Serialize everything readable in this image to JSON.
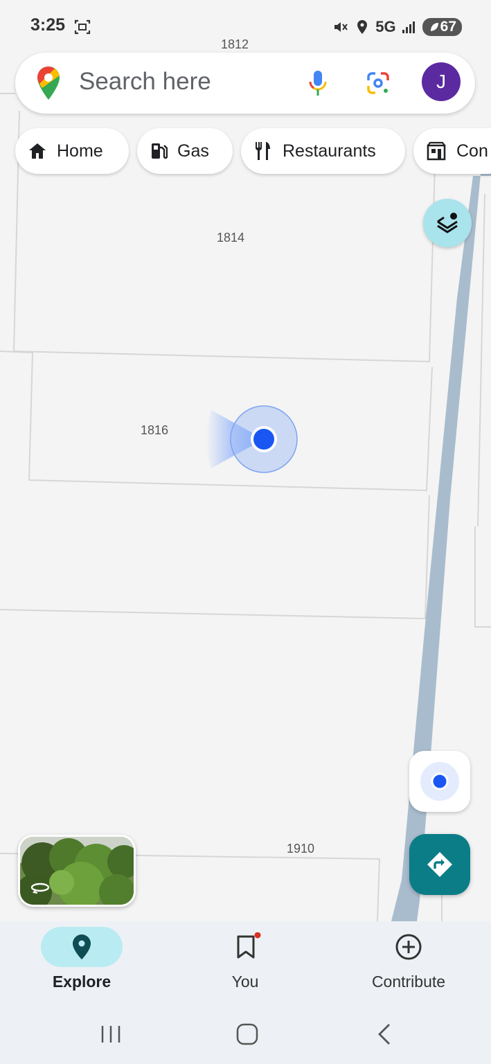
{
  "status_bar": {
    "time": "3:25",
    "network": "5G",
    "battery": "67"
  },
  "search": {
    "placeholder": "Search here",
    "avatar_initial": "J"
  },
  "chips": [
    {
      "label": "Home",
      "icon": "home-icon"
    },
    {
      "label": "Gas",
      "icon": "gas-station-icon"
    },
    {
      "label": "Restaurants",
      "icon": "restaurant-icon"
    },
    {
      "label": "Con",
      "icon": "convenience-store-icon"
    }
  ],
  "map": {
    "parcel_labels": [
      "1812",
      "1814",
      "1816",
      "1910"
    ],
    "road_color": "#a9bccd",
    "location_dot_color": "#1a57f2"
  },
  "buttons": {
    "layers": "layers-icon",
    "my_location": "my-location-icon",
    "directions": "directions-icon"
  },
  "bottom_nav": [
    {
      "label": "Explore",
      "icon": "explore-pin-icon",
      "active": true
    },
    {
      "label": "You",
      "icon": "bookmark-icon",
      "active": false
    },
    {
      "label": "Contribute",
      "icon": "add-circle-icon",
      "active": false
    }
  ],
  "colors": {
    "accent_teal": "#0b7d87",
    "active_nav_bg": "#b9ecf2",
    "avatar_bg": "#5b2aa0"
  }
}
